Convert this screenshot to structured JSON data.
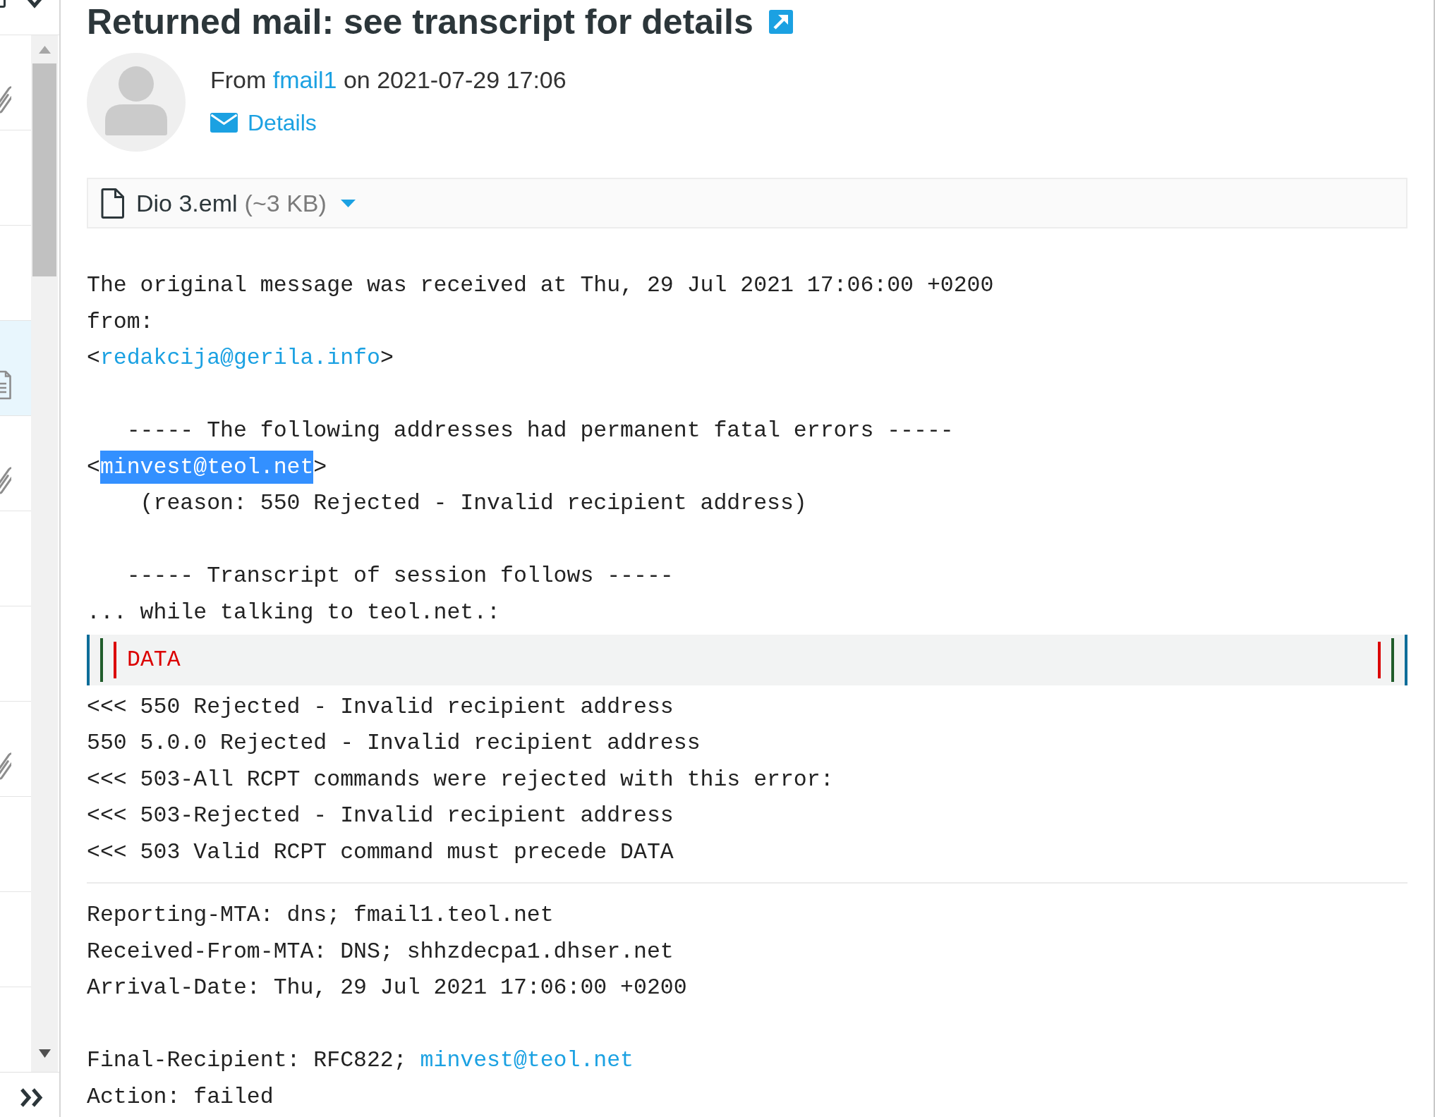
{
  "sidebar": {
    "rows": [
      {
        "kind": "attachment",
        "selected": false
      },
      {
        "kind": "plain",
        "selected": false
      },
      {
        "kind": "plain",
        "selected": false
      },
      {
        "kind": "document",
        "selected": true
      },
      {
        "kind": "attachment",
        "selected": false
      },
      {
        "kind": "plain",
        "selected": false
      },
      {
        "kind": "plain",
        "selected": false
      },
      {
        "kind": "attachment",
        "selected": false
      },
      {
        "kind": "plain",
        "selected": false
      },
      {
        "kind": "plain",
        "selected": false
      }
    ]
  },
  "message": {
    "subject": "Returned mail: see transcript for details",
    "from": {
      "label": "From",
      "sender": "fmail1",
      "date": "on 2021-07-29 17:06"
    },
    "details_link": "Details",
    "attachment": {
      "name": "Dio 3.eml",
      "size": "(~3 KB)"
    },
    "body": [
      {
        "kind": "text",
        "lines": [
          [
            {
              "kind": "plain",
              "text": "The original message was received at Thu, 29 Jul 2021 17:06:00 +0200"
            }
          ],
          [
            {
              "kind": "plain",
              "text": "from:"
            }
          ],
          [
            {
              "kind": "plain",
              "text": "<"
            },
            {
              "kind": "link",
              "text": "redakcija@gerila.info"
            },
            {
              "kind": "plain",
              "text": ">"
            }
          ]
        ]
      },
      {
        "kind": "text",
        "lines": [
          [
            {
              "kind": "plain",
              "text": "   ----- The following addresses had permanent fatal errors -----"
            }
          ],
          [
            {
              "kind": "plain",
              "text": "<"
            },
            {
              "kind": "highlight",
              "text": "minvest@teol.net"
            },
            {
              "kind": "plain",
              "text": ">"
            }
          ],
          [
            {
              "kind": "plain",
              "text": "    (reason: 550 Rejected - Invalid recipient address)"
            }
          ]
        ]
      },
      {
        "kind": "text",
        "lines": [
          [
            {
              "kind": "plain",
              "text": "   ----- Transcript of session follows -----"
            }
          ],
          [
            {
              "kind": "plain",
              "text": "... while talking to teol.net.:"
            }
          ]
        ]
      },
      {
        "kind": "quote",
        "children": [
          {
            "kind": "quote",
            "children": [
              {
                "kind": "quote",
                "children": [
                  {
                    "kind": "text",
                    "lines": [
                      [
                        {
                          "kind": "plain",
                          "text": "DATA"
                        }
                      ]
                    ]
                  }
                ]
              }
            ]
          }
        ]
      },
      {
        "kind": "text",
        "lines": [
          [
            {
              "kind": "plain",
              "text": "<<< 550 Rejected - Invalid recipient address"
            }
          ],
          [
            {
              "kind": "plain",
              "text": "550 5.0.0 Rejected - Invalid recipient address"
            }
          ],
          [
            {
              "kind": "plain",
              "text": "<<< 503-All RCPT commands were rejected with this error:"
            }
          ],
          [
            {
              "kind": "plain",
              "text": "<<< 503-Rejected - Invalid recipient address"
            }
          ],
          [
            {
              "kind": "plain",
              "text": "<<< 503 Valid RCPT command must precede DATA"
            }
          ]
        ]
      },
      {
        "kind": "rule"
      },
      {
        "kind": "text",
        "lines": [
          [
            {
              "kind": "plain",
              "text": "Reporting-MTA: dns; fmail1.teol.net"
            }
          ],
          [
            {
              "kind": "plain",
              "text": "Received-From-MTA: DNS; shhzdecpa1.dhser.net"
            }
          ],
          [
            {
              "kind": "plain",
              "text": "Arrival-Date: Thu, 29 Jul 2021 17:06:00 +0200"
            }
          ]
        ]
      },
      {
        "kind": "text",
        "lines": [
          [
            {
              "kind": "plain",
              "text": "Final-Recipient: RFC822; "
            },
            {
              "kind": "link",
              "text": "minvest@teol.net"
            }
          ],
          [
            {
              "kind": "plain",
              "text": "Action: failed"
            }
          ]
        ]
      }
    ]
  }
}
